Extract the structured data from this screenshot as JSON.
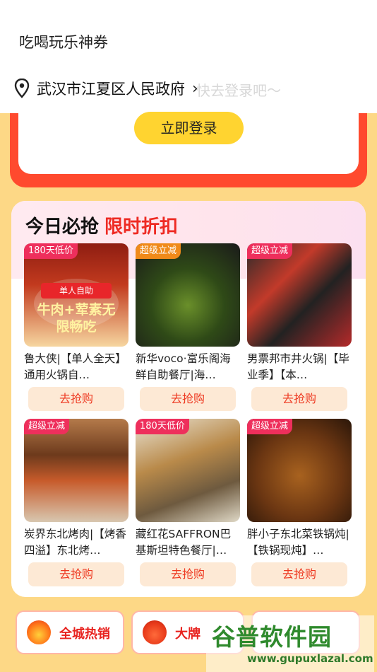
{
  "topbar": {
    "title": "吃喝玩乐神券"
  },
  "location": {
    "text": "武汉市江夏区人民政府",
    "ghost_text": "快去登录吧～"
  },
  "login": {
    "button_label": "立即登录"
  },
  "deals": {
    "heading": "今日必抢",
    "heading_highlight": "限时折扣",
    "items": [
      {
        "badge": "180天低价",
        "name": "鲁大侠|【单人全天】通用火锅自…",
        "buy_label": "去抢购",
        "thumb_text1": "单人自助",
        "thumb_text2": "牛肉+荤素无限畅吃"
      },
      {
        "badge": "超级立减",
        "name": "新华voco·富乐阁海鲜自助餐厅|海…",
        "buy_label": "去抢购"
      },
      {
        "badge": "超级立减",
        "name": "男票邦市井火锅|【毕业季】【本…",
        "buy_label": "去抢购"
      },
      {
        "badge": "超级立减",
        "name": "炭界东北烤肉|【烤香四溢】东北烤…",
        "buy_label": "去抢购"
      },
      {
        "badge": "180天低价",
        "name": "藏红花SAFFRON巴基斯坦特色餐厅|…",
        "buy_label": "去抢购"
      },
      {
        "badge": "",
        "name": "胖小子东北菜铁锅炖|【铁锅现炖】…",
        "buy_label": "去抢购"
      }
    ]
  },
  "categories": [
    {
      "label": "全城热销",
      "icon": "flame-icon"
    },
    {
      "label": "大牌",
      "icon": "hotpot-icon"
    }
  ],
  "watermark": {
    "main": "谷普软件园",
    "url": "www.gupuxlazal.com"
  }
}
